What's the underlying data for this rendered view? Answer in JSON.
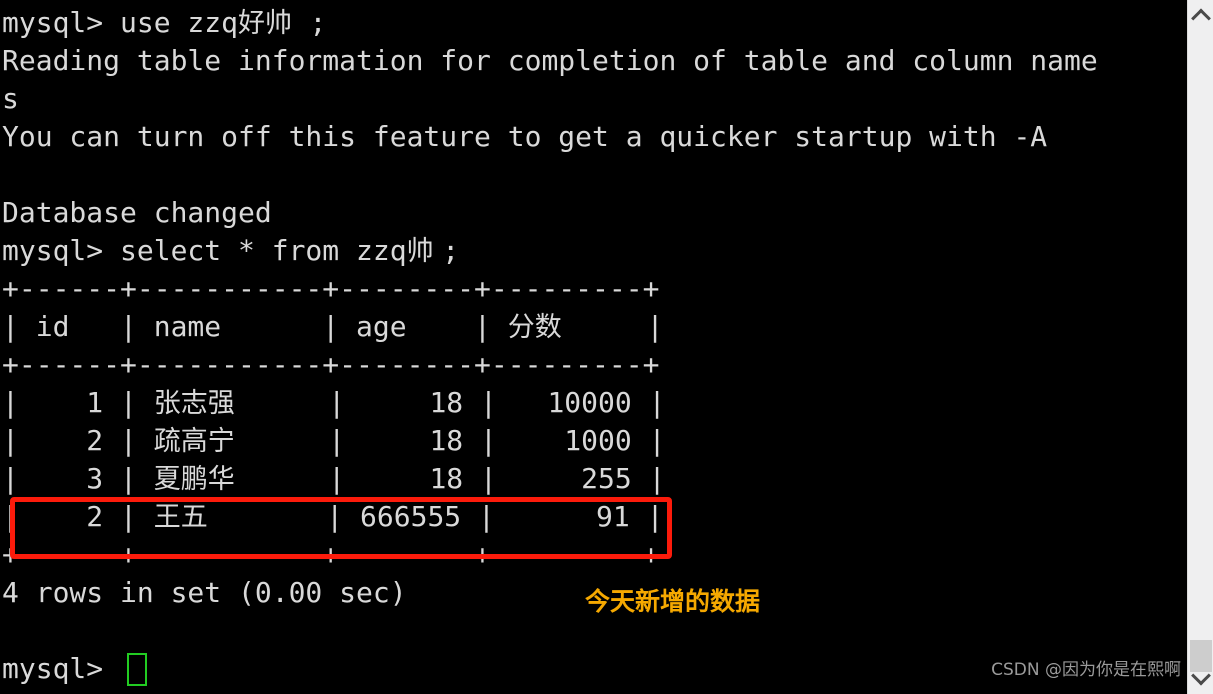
{
  "terminal": {
    "background_color": "#000000",
    "text_color": "#d9d9d9",
    "lines": [
      "mysql> use zzq好帅;",
      "Reading table information for completion of table and column name",
      "s",
      "You can turn off this feature to get a quicker startup with -A",
      "",
      "Database changed",
      "mysql> select * from zzq帅;",
      "+------+-----------+--------+---------+",
      "| id   | name      | age    | 分数    |",
      "+------+-----------+--------+---------+",
      "|    1 | 张志强    |     18 |   10000 |",
      "|    2 | 疏高宁    |     18 |    1000 |",
      "|    3 | 夏鹏华    |     18 |     255 |",
      "|    2 | 王五      | 666555 |      91 |",
      "+------+-----------+--------+---------+",
      "4 rows in set (0.00 sec)",
      "",
      "mysql> "
    ],
    "prompt": "mysql> ",
    "cursor": {
      "color": "#22cc22",
      "shape": "hollow-block"
    }
  },
  "query_result": {
    "type": "table",
    "statement": "select * from zzq帅;",
    "columns": [
      "id",
      "name",
      "age",
      "分数"
    ],
    "rows": [
      [
        "1",
        "张志强",
        "18",
        "10000"
      ],
      [
        "2",
        "疏高宁",
        "18",
        "1000"
      ],
      [
        "3",
        "夏鹏华",
        "18",
        "255"
      ],
      [
        "2",
        "王五",
        "666555",
        "91"
      ]
    ],
    "footer": "4 rows in set (0.00 sec)",
    "row_count": 4,
    "elapsed": "0.00 sec"
  },
  "annotations": {
    "highlight_box": {
      "color": "#fc1b0b",
      "target_row": "| 2 | 王五 | 666555 | 91 |"
    },
    "note": {
      "text": "今天新增的数据",
      "color": "#f5a800"
    }
  },
  "watermark": {
    "text": "CSDN @因为你是在熙啊",
    "color": "#9a9a9a"
  },
  "scrollbar": {
    "track_color": "#efeff0",
    "thumb_color": "#cdcdcd",
    "up_arrow": "chevron-up-icon",
    "down_arrow": "chevron-down-icon"
  }
}
